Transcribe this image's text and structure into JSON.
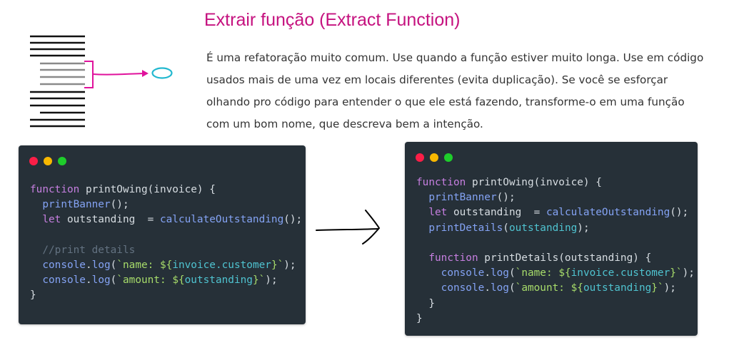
{
  "heading": "Extrair função (Extract Function)",
  "description": "É uma refatoração muito comum. Use quando a função estiver muito longa. Use em código usados mais de uma vez em locais diferentes (evita duplicação). Se você se esforçar olhando pro código para entender o que ele está fazendo, transforme-o em uma função com um bom nome, que descreva bem a intenção.",
  "colors": {
    "heading": "#c5127f",
    "diagram_bracket": "#e0129c",
    "diagram_target": "#22b8cf",
    "code_background": "#263038"
  },
  "before_code": {
    "lines": [
      [
        {
          "c": "k",
          "t": "function"
        },
        {
          "t": " printOwing(invoice) {"
        }
      ],
      [
        {
          "t": "  "
        },
        {
          "c": "f",
          "t": "printBanner"
        },
        {
          "t": "();"
        }
      ],
      [
        {
          "t": "  "
        },
        {
          "c": "k",
          "t": "let"
        },
        {
          "t": " outstanding  = "
        },
        {
          "c": "f",
          "t": "calculateOutstanding"
        },
        {
          "t": "();"
        }
      ],
      [
        {
          "t": ""
        }
      ],
      [
        {
          "t": "  "
        },
        {
          "c": "c",
          "t": "//print details"
        }
      ],
      [
        {
          "t": "  "
        },
        {
          "c": "f",
          "t": "console"
        },
        {
          "t": "."
        },
        {
          "c": "f",
          "t": "log"
        },
        {
          "t": "("
        },
        {
          "c": "s",
          "t": "`name: "
        },
        {
          "c": "s",
          "t": "${"
        },
        {
          "c": "t",
          "t": "invoice.customer"
        },
        {
          "c": "s",
          "t": "}`"
        },
        {
          "t": ");"
        }
      ],
      [
        {
          "t": "  "
        },
        {
          "c": "f",
          "t": "console"
        },
        {
          "t": "."
        },
        {
          "c": "f",
          "t": "log"
        },
        {
          "t": "("
        },
        {
          "c": "s",
          "t": "`amount: "
        },
        {
          "c": "s",
          "t": "${"
        },
        {
          "c": "t",
          "t": "outstanding"
        },
        {
          "c": "s",
          "t": "}`"
        },
        {
          "t": ");"
        }
      ],
      [
        {
          "t": "}"
        }
      ]
    ]
  },
  "after_code": {
    "lines": [
      [
        {
          "c": "k",
          "t": "function"
        },
        {
          "t": " printOwing(invoice) {"
        }
      ],
      [
        {
          "t": "  "
        },
        {
          "c": "f",
          "t": "printBanner"
        },
        {
          "t": "();"
        }
      ],
      [
        {
          "t": "  "
        },
        {
          "c": "k",
          "t": "let"
        },
        {
          "t": " outstanding  = "
        },
        {
          "c": "f",
          "t": "calculateOutstanding"
        },
        {
          "t": "();"
        }
      ],
      [
        {
          "t": "  "
        },
        {
          "c": "f",
          "t": "printDetails"
        },
        {
          "t": "("
        },
        {
          "c": "t",
          "t": "outstanding"
        },
        {
          "t": ");"
        }
      ],
      [
        {
          "t": ""
        }
      ],
      [
        {
          "t": "  "
        },
        {
          "c": "k",
          "t": "function"
        },
        {
          "t": " printDetails(outstanding) {"
        }
      ],
      [
        {
          "t": "    "
        },
        {
          "c": "f",
          "t": "console"
        },
        {
          "t": "."
        },
        {
          "c": "f",
          "t": "log"
        },
        {
          "t": "("
        },
        {
          "c": "s",
          "t": "`name: "
        },
        {
          "c": "s",
          "t": "${"
        },
        {
          "c": "t",
          "t": "invoice.customer"
        },
        {
          "c": "s",
          "t": "}`"
        },
        {
          "t": ");"
        }
      ],
      [
        {
          "t": "    "
        },
        {
          "c": "f",
          "t": "console"
        },
        {
          "t": "."
        },
        {
          "c": "f",
          "t": "log"
        },
        {
          "t": "("
        },
        {
          "c": "s",
          "t": "`amount: "
        },
        {
          "c": "s",
          "t": "${"
        },
        {
          "c": "t",
          "t": "outstanding"
        },
        {
          "c": "s",
          "t": "}`"
        },
        {
          "t": ");"
        }
      ],
      [
        {
          "t": "  }"
        }
      ],
      [
        {
          "t": "}"
        }
      ]
    ]
  }
}
